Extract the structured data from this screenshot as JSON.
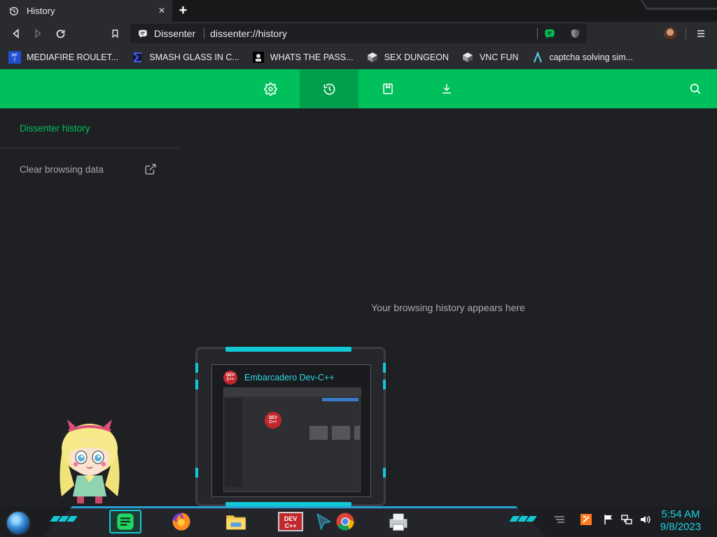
{
  "tab": {
    "title": "History",
    "close": "×"
  },
  "newtab": {
    "label": "+"
  },
  "omnibox": {
    "site": "Dissenter",
    "url": "dissenter://history"
  },
  "bookmarks": [
    {
      "label": "MEDIAFIRE ROULET...",
      "icon": "mediafire-icon"
    },
    {
      "label": "SMASH GLASS IN C...",
      "icon": "sigma-icon"
    },
    {
      "label": "WHATS THE PASS...",
      "icon": "mask-icon"
    },
    {
      "label": "SEX DUNGEON",
      "icon": "vnc-icon"
    },
    {
      "label": "VNC FUN",
      "icon": "vnc-icon"
    },
    {
      "label": "captcha solving sim...",
      "icon": "lambda-icon"
    }
  ],
  "greenbar": {
    "tabs": [
      "settings",
      "history",
      "bookmarks",
      "downloads"
    ],
    "active": "history"
  },
  "sidebar": {
    "title": "Dissenter history",
    "clear": "Clear browsing data"
  },
  "main": {
    "empty_message": "Your browsing history appears here"
  },
  "preview": {
    "title": "Embarcadero Dev-C++",
    "logo": "DEV C++"
  },
  "taskbar": {
    "apps": [
      "notes",
      "firefox",
      "explorer",
      "devcpp",
      "cursor-app",
      "chrome",
      "printer-app"
    ]
  },
  "clock": {
    "time": "5:54 AM",
    "date": "9/8/2023"
  },
  "colors": {
    "accent_green": "#00c05b",
    "active_green": "#009f4b",
    "cyan": "#13c8d6",
    "background": "#1f2023"
  }
}
